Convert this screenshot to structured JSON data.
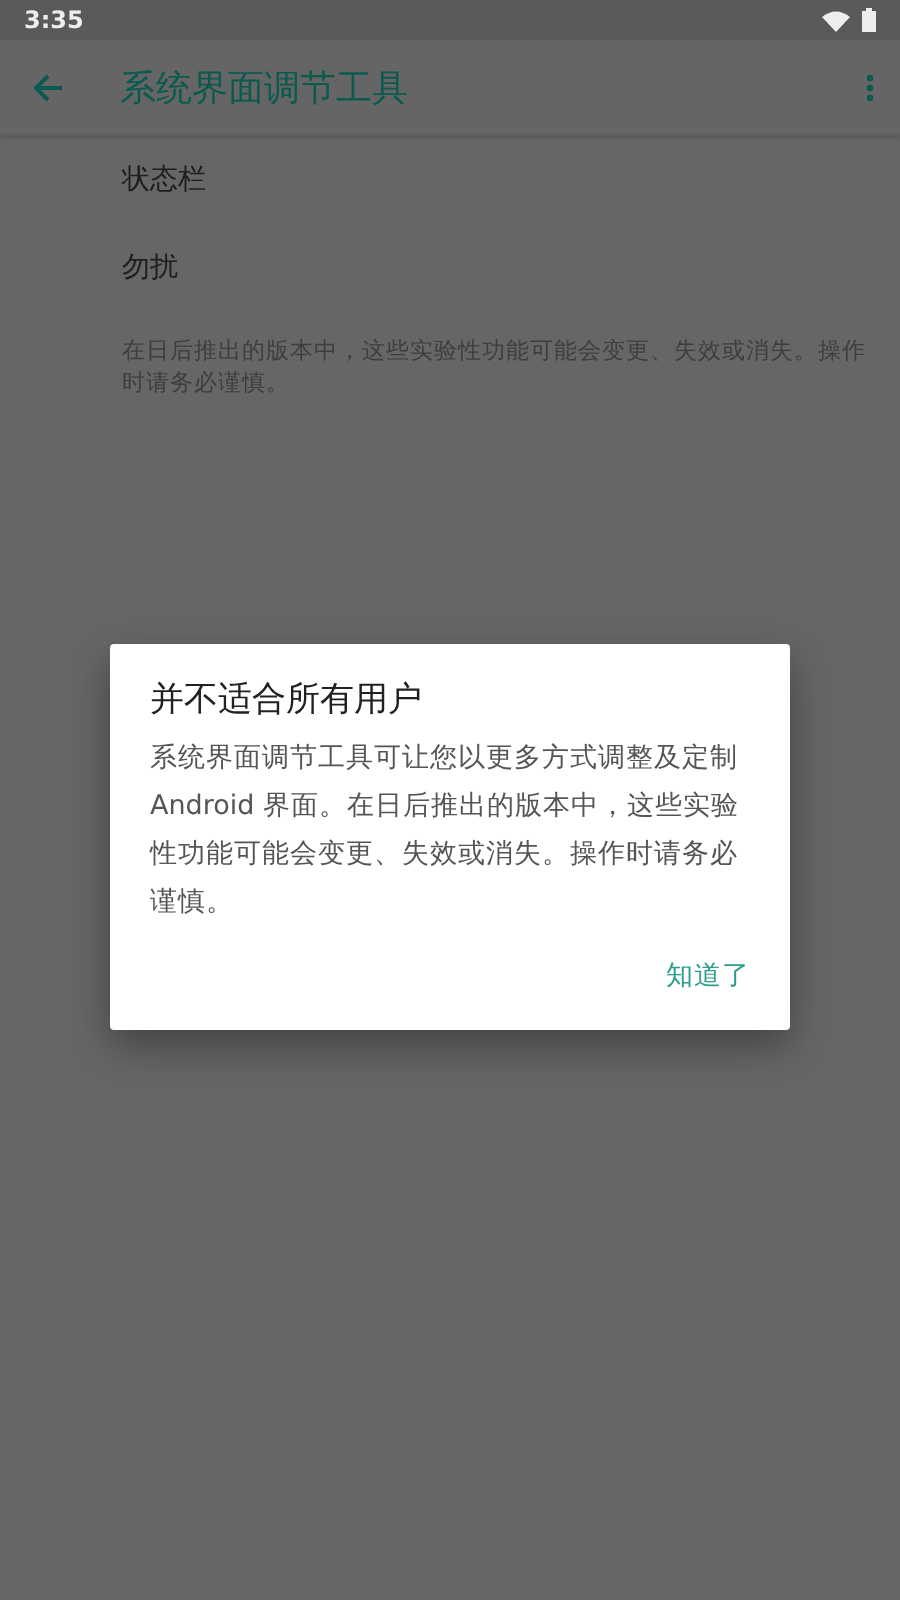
{
  "status_bar": {
    "time": "3:35"
  },
  "app_bar": {
    "title": "系统界面调节工具"
  },
  "settings": [
    {
      "kind": "item",
      "label": "状态栏"
    },
    {
      "kind": "item",
      "label": "勿扰"
    },
    {
      "kind": "note",
      "label": "在日后推出的版本中，这些实验性功能可能会变更、失效或消失。操作时请务必谨慎。"
    }
  ],
  "dialog": {
    "title": "并不适合所有用户",
    "message": "系统界面调节工具可让您以更多方式调整及定制 Android 界面。在日后推出的版本中，这些实验性功能可能会变更、失效或消失。操作时请务必谨慎。",
    "button": "知道了"
  }
}
